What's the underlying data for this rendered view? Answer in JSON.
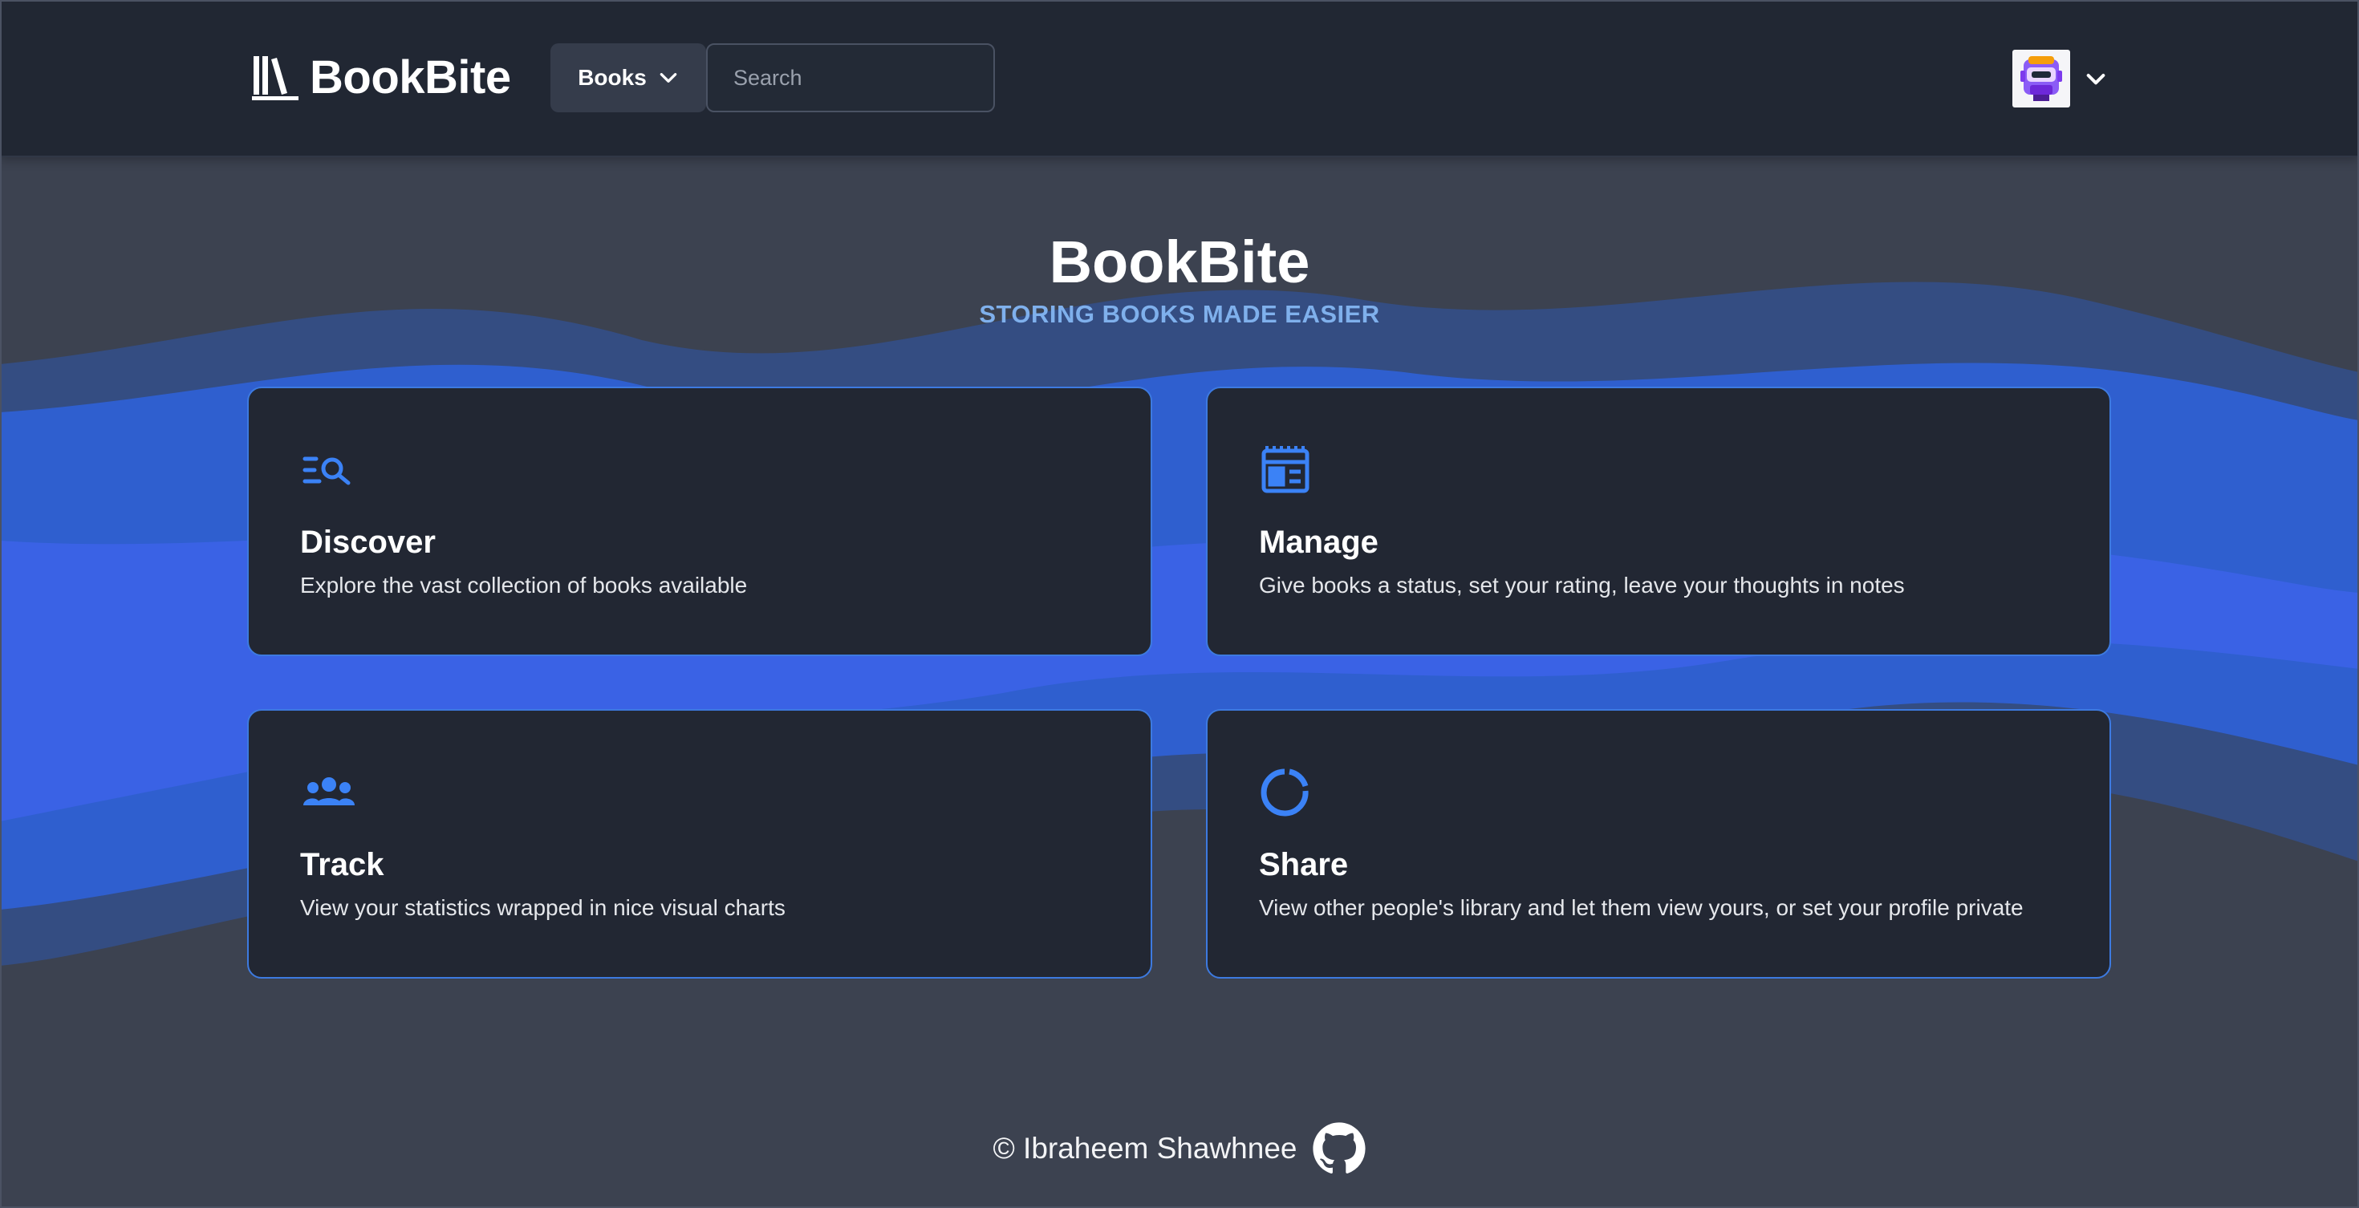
{
  "header": {
    "brand": "BookBite",
    "books_label": "Books",
    "search_placeholder": "Search"
  },
  "hero": {
    "title": "BookBite",
    "subtitle": "STORING BOOKS MADE EASIER"
  },
  "features": [
    {
      "icon": "search-list-icon",
      "title": "Discover",
      "description": "Explore the vast collection of books available"
    },
    {
      "icon": "newspaper-icon",
      "title": "Manage",
      "description": "Give books a status, set your rating, leave your thoughts in notes"
    },
    {
      "icon": "users-icon",
      "title": "Track",
      "description": "View your statistics wrapped in nice visual charts"
    },
    {
      "icon": "donut-chart-icon",
      "title": "Share",
      "description": "View other people's library and let them view yours, or set your profile private"
    }
  ],
  "footer": {
    "credit": "© Ibraheem Shawhnee"
  },
  "colors": {
    "header_bg": "#212733",
    "page_bg": "#3c4250",
    "card_bg": "#222733",
    "accent_blue": "#3d7ae0",
    "subtitle": "#7fb0ec"
  }
}
